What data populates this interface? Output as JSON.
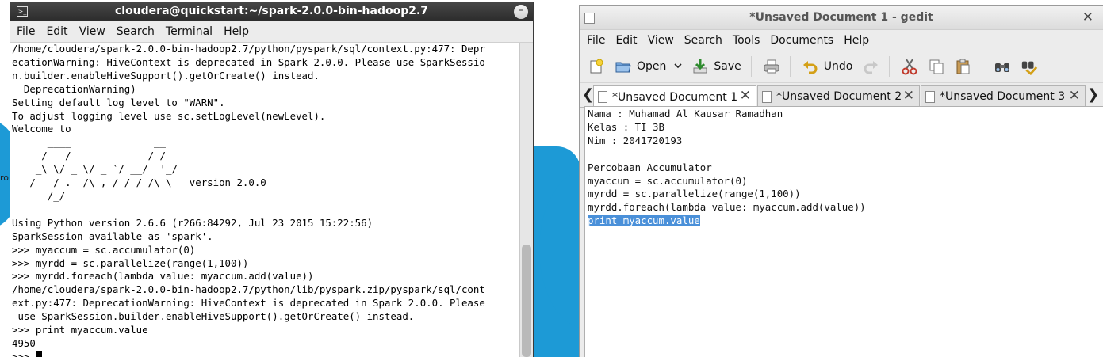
{
  "desktop": {
    "edge_text": "ro",
    "accent": "#1d9ad6"
  },
  "terminal": {
    "title": "cloudera@quickstart:~/spark-2.0.0-bin-hadoop2.7",
    "menu": [
      "File",
      "Edit",
      "View",
      "Search",
      "Terminal",
      "Help"
    ],
    "lines": [
      "/home/cloudera/spark-2.0.0-bin-hadoop2.7/python/pyspark/sql/context.py:477: Depr",
      "ecationWarning: HiveContext is deprecated in Spark 2.0.0. Please use SparkSessio",
      "n.builder.enableHiveSupport().getOrCreate() instead.",
      "  DeprecationWarning)",
      "Setting default log level to \"WARN\".",
      "To adjust logging level use sc.setLogLevel(newLevel).",
      "Welcome to",
      "      ____              __",
      "     / __/__  ___ _____/ /__",
      "    _\\ \\/ _ \\/ _ `/ __/  '_/",
      "   /__ / .__/\\_,_/_/ /_/\\_\\   version 2.0.0",
      "      /_/",
      "",
      "Using Python version 2.6.6 (r266:84292, Jul 23 2015 15:22:56)",
      "SparkSession available as 'spark'.",
      ">>> myaccum = sc.accumulator(0)",
      ">>> myrdd = sc.parallelize(range(1,100))",
      ">>> myrdd.foreach(lambda value: myaccum.add(value))",
      "/home/cloudera/spark-2.0.0-bin-hadoop2.7/python/lib/pyspark.zip/pyspark/sql/cont",
      "ext.py:477: DeprecationWarning: HiveContext is deprecated in Spark 2.0.0. Please",
      " use SparkSession.builder.enableHiveSupport().getOrCreate() instead.",
      ">>> print myaccum.value",
      "4950"
    ],
    "prompt": ">>> "
  },
  "gedit": {
    "title": "*Unsaved Document 1 - gedit",
    "menu": [
      "File",
      "Edit",
      "View",
      "Search",
      "Tools",
      "Documents",
      "Help"
    ],
    "toolbar": {
      "open": "Open",
      "save": "Save",
      "undo": "Undo"
    },
    "tabs": [
      "*Unsaved Document 1",
      "*Unsaved Document 2",
      "*Unsaved Document 3"
    ],
    "editor_lines": [
      "Nama : Muhamad Al Kausar Ramadhan",
      "Kelas : TI 3B",
      "Nim : 2041720193",
      "",
      "Percobaan Accumulator",
      "myaccum = sc.accumulator(0)",
      "myrdd = sc.parallelize(range(1,100))",
      "myrdd.foreach(lambda value: myaccum.add(value))"
    ],
    "selected_line": "print myaccum.value",
    "selection_color": "#4a90d9"
  }
}
